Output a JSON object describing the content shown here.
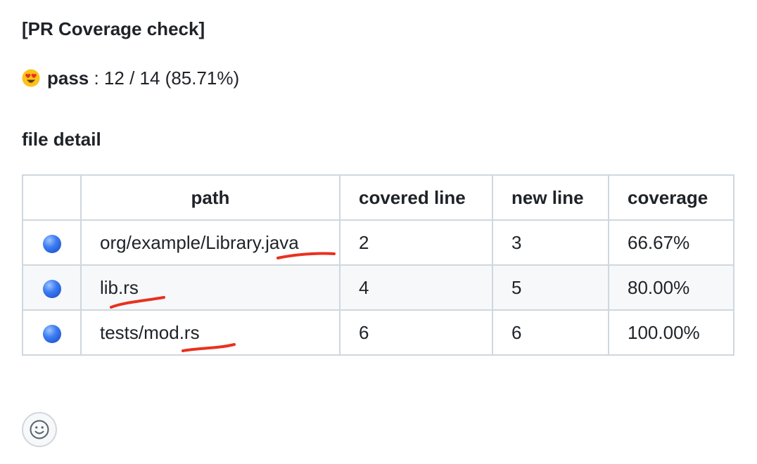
{
  "comment": {
    "title": "[PR Coverage check]",
    "status": {
      "emoji_icon": "heart-eyes-emoji",
      "label": "pass",
      "summary": " : 12 / 14 (85.71%)"
    },
    "detail_heading": "file detail"
  },
  "table": {
    "headers": [
      "",
      "path",
      "covered line",
      "new line",
      "coverage"
    ],
    "rows": [
      {
        "icon": "blue-circle-icon",
        "path": "org/example/Library.java",
        "covered": "2",
        "new": "3",
        "coverage": "66.67%"
      },
      {
        "icon": "blue-circle-icon",
        "path": "lib.rs",
        "covered": "4",
        "new": "5",
        "coverage": "80.00%"
      },
      {
        "icon": "blue-circle-icon",
        "path": "tests/mod.rs",
        "covered": "6",
        "new": "6",
        "coverage": "100.00%"
      }
    ]
  },
  "annotations": {
    "underline_color": "#e8311f"
  },
  "reaction_button": {
    "icon": "smiley-icon"
  }
}
